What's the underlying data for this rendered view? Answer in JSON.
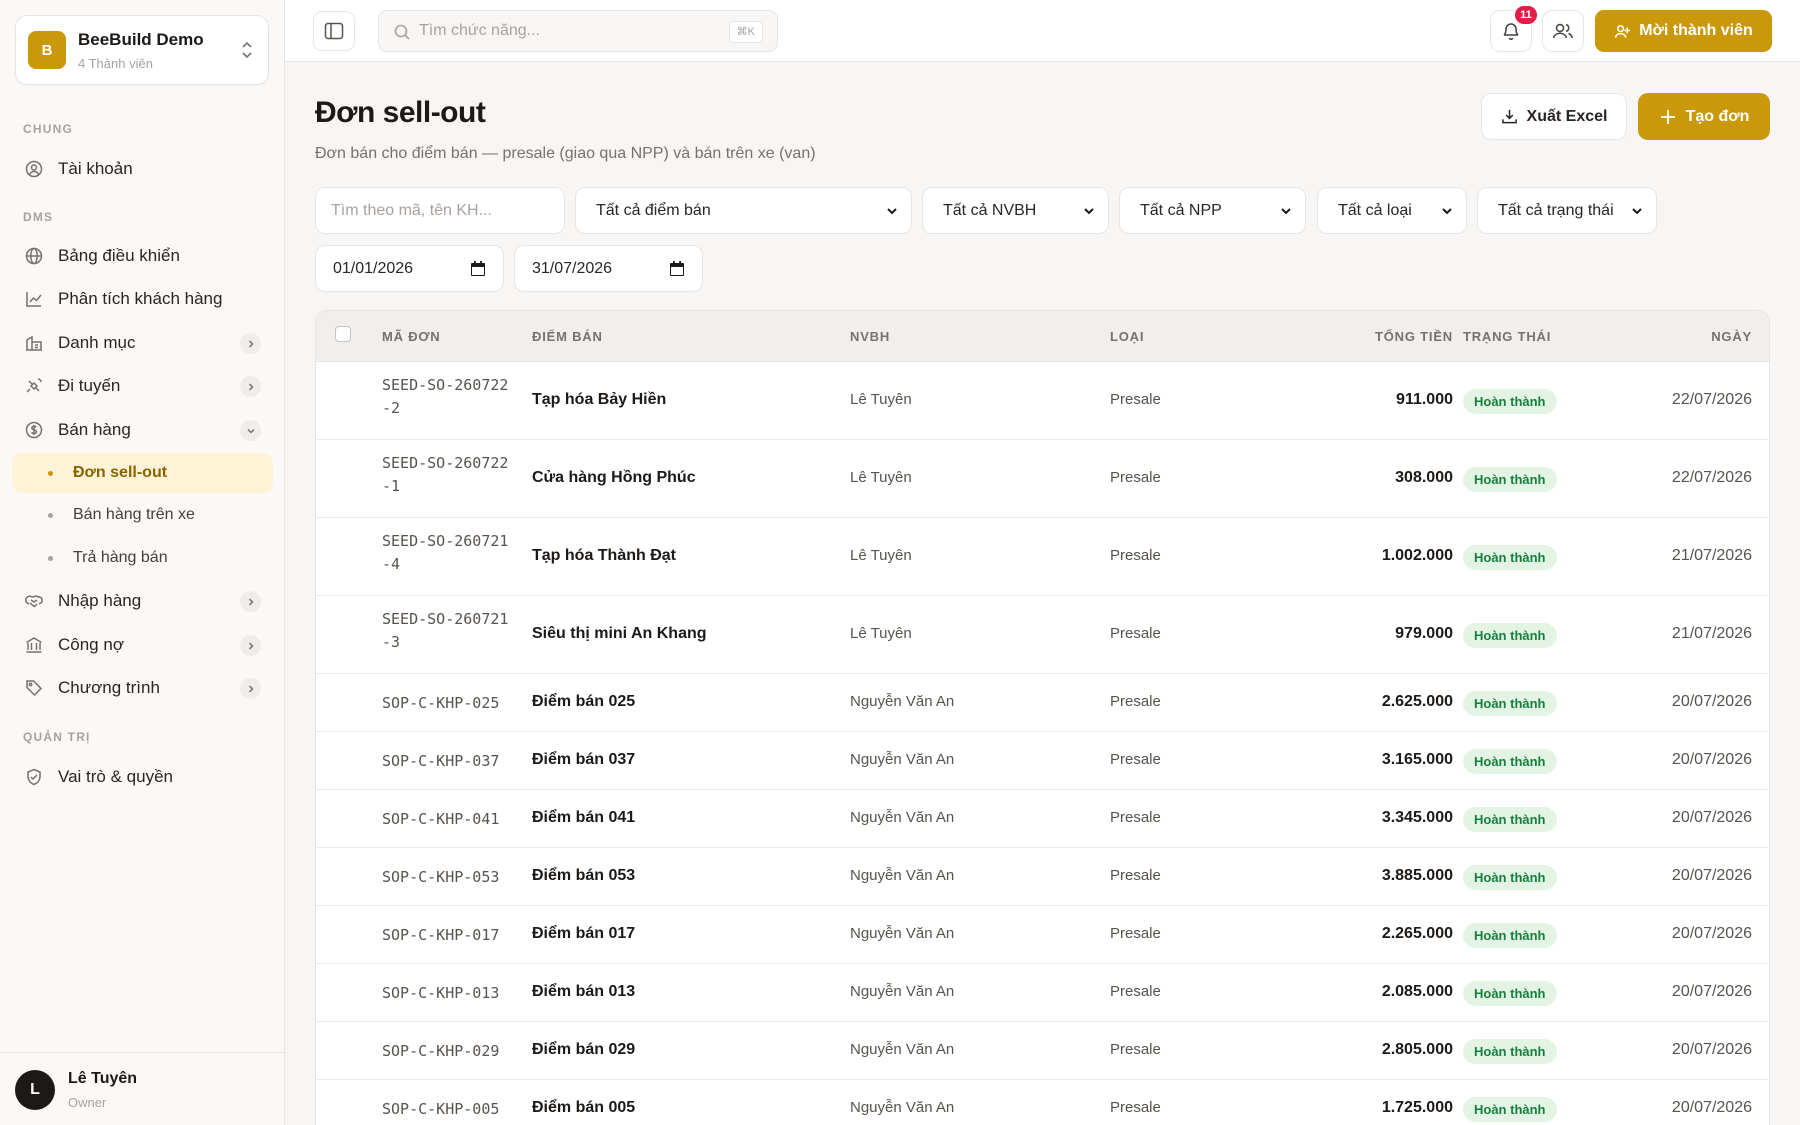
{
  "org": {
    "logo": "B",
    "name": "BeeBuild Demo",
    "members": "4 Thành viên"
  },
  "sidebar": {
    "sections": {
      "general": "CHUNG",
      "dms": "DMS",
      "admin": "QUẢN TRỊ"
    },
    "items": {
      "account": "Tài khoản",
      "dashboard": "Bảng điều khiển",
      "customer_analysis": "Phân tích khách hàng",
      "catalog": "Danh mục",
      "routes": "Đi tuyến",
      "sales": "Bán hàng",
      "sellout": "Đơn sell-out",
      "van_sales": "Bán hàng trên xe",
      "returns": "Trả hàng bán",
      "purchasing": "Nhập hàng",
      "debts": "Công nợ",
      "programs": "Chương trình",
      "roles": "Vai trò & quyền"
    }
  },
  "user": {
    "initial": "L",
    "name": "Lê Tuyên",
    "role": "Owner"
  },
  "topbar": {
    "search_placeholder": "Tìm chức năng...",
    "shortcut": "⌘K",
    "notifications": "11",
    "invite_label": "Mời thành viên"
  },
  "page": {
    "title": "Đơn sell-out",
    "subtitle": "Đơn bán cho điểm bán — presale (giao qua NPP) và bán trên xe (van)",
    "export_label": "Xuất Excel",
    "create_label": "Tạo đơn"
  },
  "filters": {
    "search_placeholder": "Tìm theo mã, tên KH...",
    "outlet": "Tất cả điểm bán",
    "salesman": "Tất cả NVBH",
    "distributor": "Tất cả NPP",
    "type": "Tất cả loại",
    "status": "Tất cả trạng thái",
    "date_from": "01/01/2026",
    "date_to": "31/07/2026"
  },
  "table": {
    "headers": {
      "code": "MÃ ĐƠN",
      "outlet": "ĐIỂM BÁN",
      "salesman": "NVBH",
      "type": "LOẠI",
      "total": "TỔNG TIỀN",
      "status": "TRẠNG THÁI",
      "date": "NGÀY"
    },
    "rows": [
      {
        "code": "SEED-SO-260722-2",
        "outlet": "Tạp hóa Bảy Hiền",
        "salesman": "Lê Tuyên",
        "type": "Presale",
        "total": "911.000",
        "status": "Hoàn thành",
        "date": "22/07/2026"
      },
      {
        "code": "SEED-SO-260722-1",
        "outlet": "Cửa hàng Hồng Phúc",
        "salesman": "Lê Tuyên",
        "type": "Presale",
        "total": "308.000",
        "status": "Hoàn thành",
        "date": "22/07/2026"
      },
      {
        "code": "SEED-SO-260721-4",
        "outlet": "Tạp hóa Thành Đạt",
        "salesman": "Lê Tuyên",
        "type": "Presale",
        "total": "1.002.000",
        "status": "Hoàn thành",
        "date": "21/07/2026"
      },
      {
        "code": "SEED-SO-260721-3",
        "outlet": "Siêu thị mini An Khang",
        "salesman": "Lê Tuyên",
        "type": "Presale",
        "total": "979.000",
        "status": "Hoàn thành",
        "date": "21/07/2026"
      },
      {
        "code": "SOP-C-KHP-025",
        "outlet": "Điểm bán 025",
        "salesman": "Nguyễn Văn An",
        "type": "Presale",
        "total": "2.625.000",
        "status": "Hoàn thành",
        "date": "20/07/2026"
      },
      {
        "code": "SOP-C-KHP-037",
        "outlet": "Điểm bán 037",
        "salesman": "Nguyễn Văn An",
        "type": "Presale",
        "total": "3.165.000",
        "status": "Hoàn thành",
        "date": "20/07/2026"
      },
      {
        "code": "SOP-C-KHP-041",
        "outlet": "Điểm bán 041",
        "salesman": "Nguyễn Văn An",
        "type": "Presale",
        "total": "3.345.000",
        "status": "Hoàn thành",
        "date": "20/07/2026"
      },
      {
        "code": "SOP-C-KHP-053",
        "outlet": "Điểm bán 053",
        "salesman": "Nguyễn Văn An",
        "type": "Presale",
        "total": "3.885.000",
        "status": "Hoàn thành",
        "date": "20/07/2026"
      },
      {
        "code": "SOP-C-KHP-017",
        "outlet": "Điểm bán 017",
        "salesman": "Nguyễn Văn An",
        "type": "Presale",
        "total": "2.265.000",
        "status": "Hoàn thành",
        "date": "20/07/2026"
      },
      {
        "code": "SOP-C-KHP-013",
        "outlet": "Điểm bán 013",
        "salesman": "Nguyễn Văn An",
        "type": "Presale",
        "total": "2.085.000",
        "status": "Hoàn thành",
        "date": "20/07/2026"
      },
      {
        "code": "SOP-C-KHP-029",
        "outlet": "Điểm bán 029",
        "salesman": "Nguyễn Văn An",
        "type": "Presale",
        "total": "2.805.000",
        "status": "Hoàn thành",
        "date": "20/07/2026"
      },
      {
        "code": "SOP-C-KHP-005",
        "outlet": "Điểm bán 005",
        "salesman": "Nguyễn Văn An",
        "type": "Presale",
        "total": "1.725.000",
        "status": "Hoàn thành",
        "date": "20/07/2026"
      }
    ]
  }
}
